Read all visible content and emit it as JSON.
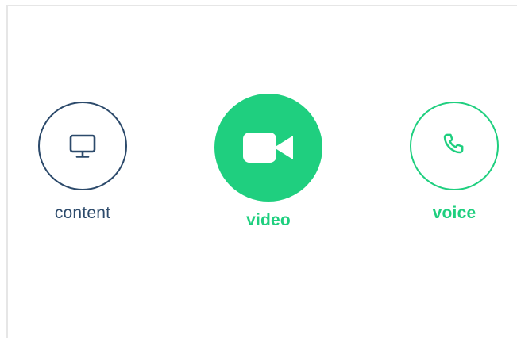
{
  "options": {
    "content": {
      "label": "content",
      "icon": "monitor-icon",
      "color": "#2c4a6b"
    },
    "video": {
      "label": "video",
      "icon": "video-camera-icon",
      "color": "#1fcf7f",
      "selected": true
    },
    "voice": {
      "label": "voice",
      "icon": "phone-icon",
      "color": "#1fcf7f"
    }
  },
  "colors": {
    "accent": "#1fcf7f",
    "navy": "#2c4a6b",
    "border": "#e6e6e6",
    "background": "#ffffff"
  }
}
